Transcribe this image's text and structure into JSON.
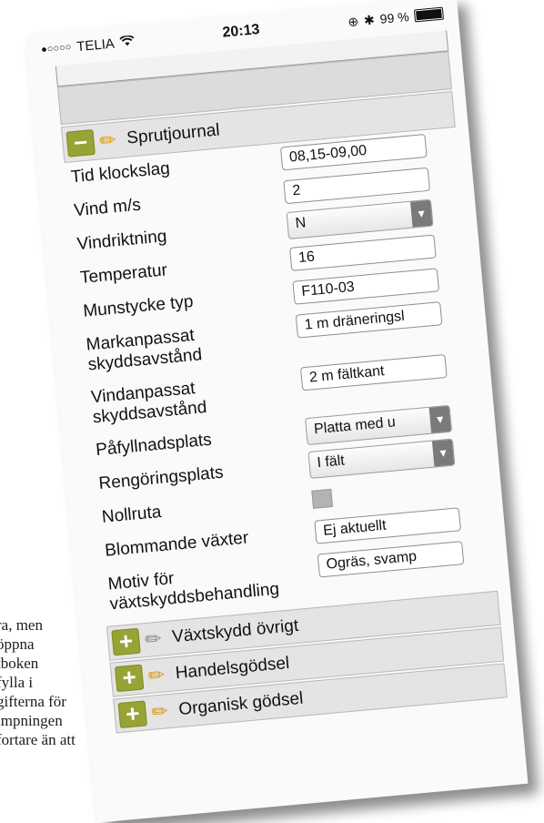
{
  "background_text": {
    "lines": [
      "ra, men",
      "öppna",
      "tboken",
      "fylla i",
      "gifterna för",
      "impningen",
      "fortare än att"
    ]
  },
  "status_bar": {
    "signal": "●○○○○",
    "carrier": "TELIA",
    "wifi_icon": "wifi-icon",
    "time": "20:13",
    "battery_percent": "99 %"
  },
  "section_open": {
    "toggle": "−",
    "title": "Sprutjournal"
  },
  "fields": [
    {
      "label": "Tid klockslag",
      "value": "08,15-09,00",
      "type": "text"
    },
    {
      "label": "Vind m/s",
      "value": "2",
      "type": "text"
    },
    {
      "label": "Vindriktning",
      "value": "N",
      "type": "select"
    },
    {
      "label": "Temperatur",
      "value": "16",
      "type": "text"
    },
    {
      "label": "Munstycke typ",
      "value": "F110-03",
      "type": "text"
    },
    {
      "label": "Markanpassat skyddsavstånd",
      "value": "1 m dräneringsl",
      "type": "text"
    },
    {
      "label": "Vindanpassat skyddsavstånd",
      "value": "2 m fältkant",
      "type": "text"
    },
    {
      "label": "Påfyllnadsplats",
      "value": "Platta med u",
      "type": "select"
    },
    {
      "label": "Rengöringsplats",
      "value": "I fält",
      "type": "select"
    },
    {
      "label": "Nollruta",
      "value": "",
      "type": "checkbox"
    },
    {
      "label": "Blommande växter",
      "value": "Ej aktuellt",
      "type": "text"
    },
    {
      "label": "Motiv för växtskyddsbehandling",
      "value": "Ogräs, svamp",
      "type": "text"
    }
  ],
  "collapsed_sections": [
    {
      "toggle": "+",
      "title": "Växtskydd övrigt",
      "pen": "grey"
    },
    {
      "toggle": "+",
      "title": "Handelsgödsel",
      "pen": "yellow"
    },
    {
      "toggle": "+",
      "title": "Organisk gödsel",
      "pen": "yellow"
    }
  ],
  "colors": {
    "toggle_green": "#98a336",
    "pen_yellow": "#d79b10",
    "section_bg": "#e4e4e4"
  }
}
